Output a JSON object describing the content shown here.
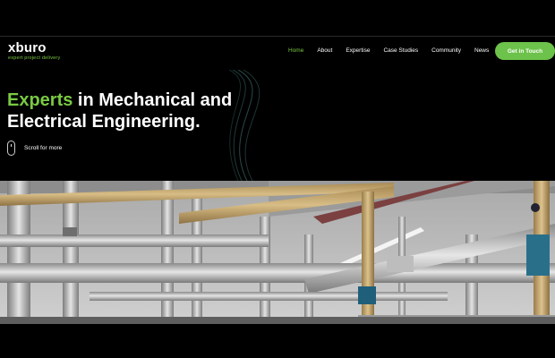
{
  "brand": {
    "logo_text": "xburo",
    "tagline": "expert project delivery",
    "accent": "#7ac943"
  },
  "nav": {
    "items": [
      {
        "label": "Home",
        "active": true
      },
      {
        "label": "About"
      },
      {
        "label": "Expertise"
      },
      {
        "label": "Case Studies"
      },
      {
        "label": "Community"
      },
      {
        "label": "News"
      }
    ],
    "cta_label": "Get in Touch"
  },
  "hero": {
    "headline_accent": "Experts",
    "headline_rest_line1": " in Mechanical and",
    "headline_line2": "Electrical Engineering.",
    "scroll_label": "Scroll for more",
    "scroll_icon": "mouse-icon"
  },
  "banner": {
    "image_subject": "industrial-pipework-photo"
  }
}
